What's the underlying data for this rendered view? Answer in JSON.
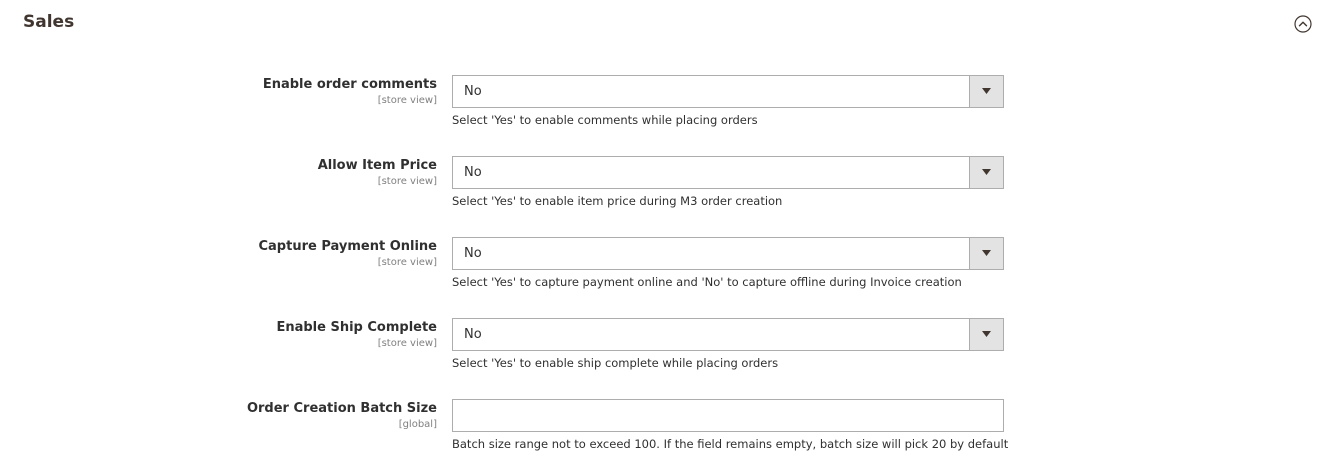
{
  "section": {
    "title": "Sales",
    "toggle_icon": "chevron-up-circle-icon"
  },
  "fields": [
    {
      "label": "Enable order comments",
      "scope": "[store view]",
      "type": "select",
      "value": "No",
      "note": "Select 'Yes' to enable comments while placing orders"
    },
    {
      "label": "Allow Item Price",
      "scope": "[store view]",
      "type": "select",
      "value": "No",
      "note": "Select 'Yes' to enable item price during M3 order creation"
    },
    {
      "label": "Capture Payment Online",
      "scope": "[store view]",
      "type": "select",
      "value": "No",
      "note": "Select 'Yes' to capture payment online and 'No' to capture offline during Invoice creation"
    },
    {
      "label": "Enable Ship Complete",
      "scope": "[store view]",
      "type": "select",
      "value": "No",
      "note": "Select 'Yes' to enable ship complete while placing orders"
    },
    {
      "label": "Order Creation Batch Size",
      "scope": "[global]",
      "type": "text",
      "value": "",
      "note": "Batch size range not to exceed 100. If the field remains empty, batch size will pick 20 by default"
    }
  ]
}
